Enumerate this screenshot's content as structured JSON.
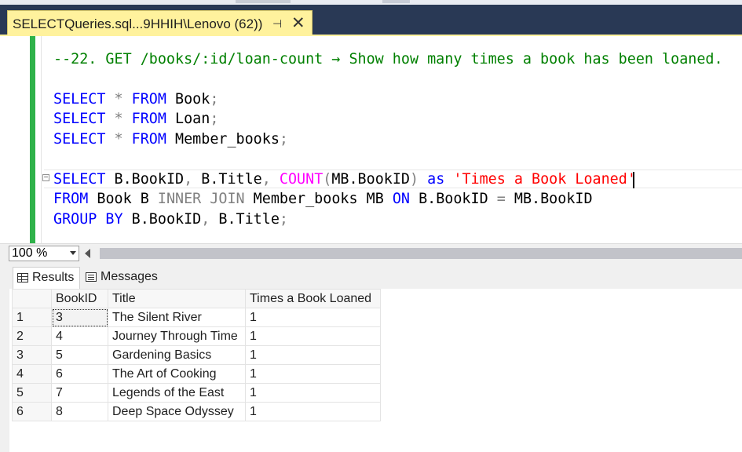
{
  "tab": {
    "title": "SELECTQueries.sql...9HHIH\\Lenovo (62))",
    "pin_glyph": "⊣",
    "close_glyph": "✕"
  },
  "editor": {
    "comment": "--22. GET /books/:id/loan-count → Show how many times a book has been loaned.",
    "lines": [
      {
        "kw": "SELECT",
        "star": " * ",
        "from": "FROM",
        "table": " Book",
        "semi": ";"
      },
      {
        "kw": "SELECT",
        "star": " * ",
        "from": "FROM",
        "table": " Loan",
        "semi": ";"
      },
      {
        "kw": "SELECT",
        "star": " * ",
        "from": "FROM",
        "table": " Member_books",
        "semi": ";"
      }
    ],
    "q1": {
      "select": "SELECT",
      "cols": " B.BookID",
      "comma1": ",",
      "col2": " B.Title",
      "comma2": ",",
      "count": " COUNT",
      "paren_open": "(",
      "arg": "MB.BookID",
      "paren_close": ")",
      "as": " as ",
      "alias": "'Times a Book Loaned'"
    },
    "q2": {
      "from": "FROM",
      "t1": " Book B ",
      "join": "INNER JOIN",
      "t2": " Member_books MB ",
      "on": "ON",
      "c1": " B.BookID ",
      "eq": "=",
      "c2": " MB.BookID"
    },
    "q3": {
      "group": "GROUP BY",
      "c1": " B.BookID",
      "comma": ",",
      "c2": " B.Title",
      "semi": ";"
    }
  },
  "zoom": {
    "value": "100 %"
  },
  "result_tabs": {
    "results": "Results",
    "messages": "Messages"
  },
  "grid": {
    "headers": [
      "",
      "BookID",
      "Title",
      "Times a Book Loaned"
    ],
    "rows": [
      [
        "1",
        "3",
        "The Silent River",
        "1"
      ],
      [
        "2",
        "4",
        "Journey Through Time",
        "1"
      ],
      [
        "3",
        "5",
        "Gardening Basics",
        "1"
      ],
      [
        "4",
        "6",
        "The Art of Cooking",
        "1"
      ],
      [
        "5",
        "7",
        "Legends of the East",
        "1"
      ],
      [
        "6",
        "8",
        "Deep Space Odyssey",
        "1"
      ]
    ]
  },
  "colors": {
    "keyword": "#0000ff",
    "comment": "#008000",
    "function": "#ff00ff",
    "string": "#ff0000",
    "operator": "#808080",
    "tab_active": "#fff29d",
    "chrome": "#293955"
  }
}
